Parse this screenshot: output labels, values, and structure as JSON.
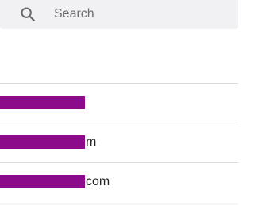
{
  "search": {
    "placeholder": "Search",
    "icon": "search-icon"
  },
  "colors": {
    "search_background": "#f1f1f3",
    "redaction": "#8b0b8b",
    "divider": "#dcdcdc"
  },
  "list": {
    "items": [
      {
        "visible_text": ""
      },
      {
        "visible_text": "m"
      },
      {
        "visible_text": "com"
      }
    ]
  }
}
